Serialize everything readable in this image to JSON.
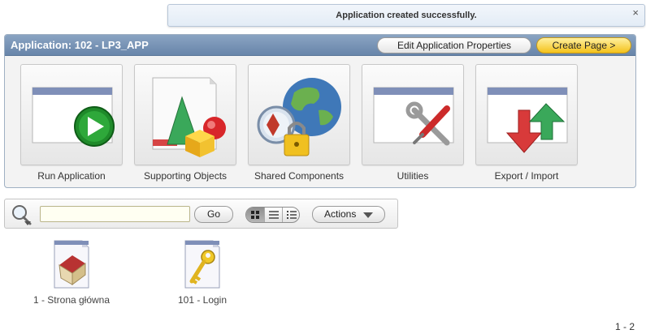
{
  "message": {
    "text": "Application created successfully.",
    "close": "×"
  },
  "region": {
    "title": "Application: 102 - LP3_APP",
    "edit_label": "Edit Application Properties",
    "create_label": "Create Page >"
  },
  "tiles": [
    {
      "label": "Run Application",
      "icon": "run-application-icon"
    },
    {
      "label": "Supporting Objects",
      "icon": "supporting-objects-icon"
    },
    {
      "label": "Shared Components",
      "icon": "shared-components-icon"
    },
    {
      "label": "Utilities",
      "icon": "utilities-icon"
    },
    {
      "label": "Export / Import",
      "icon": "export-import-icon"
    }
  ],
  "search": {
    "value": "",
    "go_label": "Go",
    "actions_label": "Actions",
    "view_selected": "icons"
  },
  "pages": [
    {
      "label": "1 - Strona główna",
      "icon": "home-page-icon"
    },
    {
      "label": "101 - Login",
      "icon": "login-page-icon"
    }
  ],
  "pagination": "1 - 2"
}
